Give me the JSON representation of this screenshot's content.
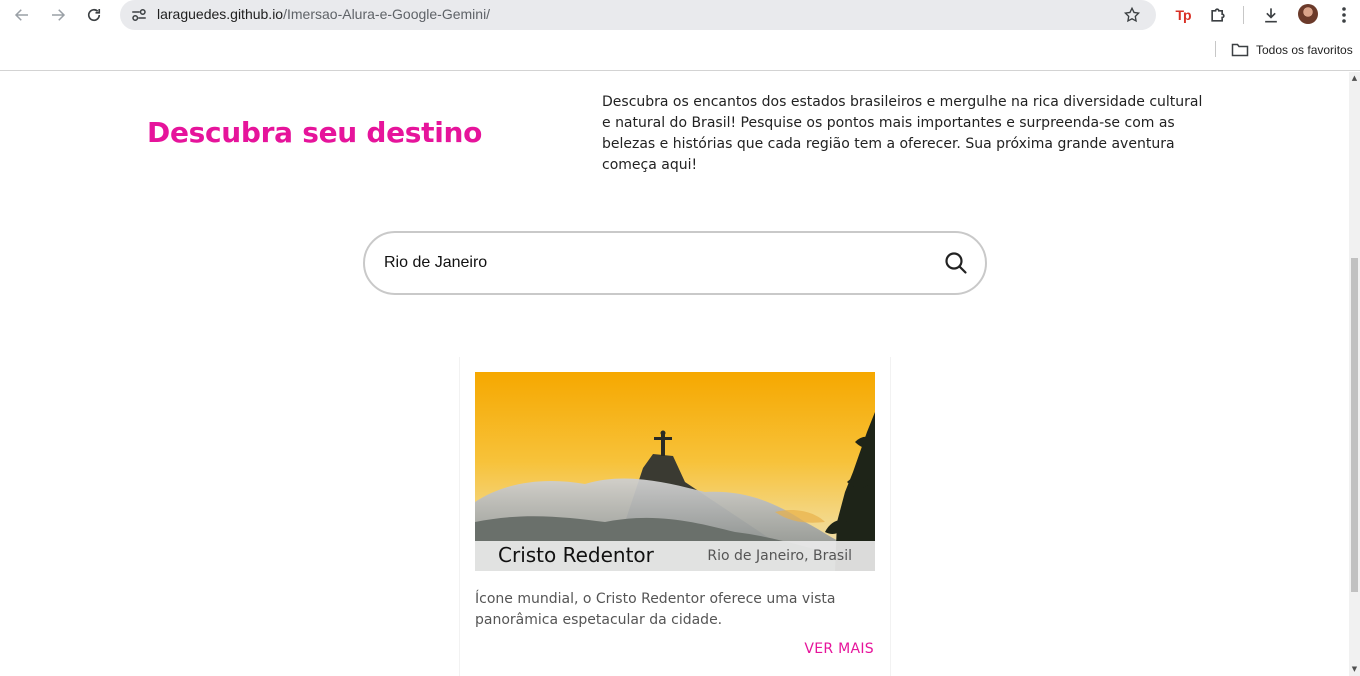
{
  "browser": {
    "url_host": "laraguedes.github.io",
    "url_path": "/Imersao-Alura-e-Google-Gemini/",
    "extension_badge": "Tp",
    "bookmarks_folder_label": "Todos os favoritos",
    "icons": [
      "back-icon",
      "forward-icon",
      "reload-icon",
      "site-info-icon",
      "star-icon",
      "extensions-icon",
      "download-icon",
      "menu-icon",
      "folder-icon"
    ]
  },
  "header": {
    "title": "Descubra seu destino",
    "intro": "Descubra os encantos dos estados brasileiros e mergulhe na rica diversidade cultural e natural do Brasil! Pesquise os pontos mais importantes e surpreenda-se com as belezas e histórias que cada região tem a oferecer. Sua próxima grande aventura começa aqui!"
  },
  "search": {
    "value": "Rio de Janeiro",
    "placeholder": ""
  },
  "results": [
    {
      "title": "Cristo Redentor",
      "location": "Rio de Janeiro, Brasil",
      "description": "Ícone mundial, o Cristo Redentor oferece uma vista panorâmica espetacular da cidade.",
      "link_label": "VER MAIS"
    }
  ],
  "colors": {
    "accent": "#e6149b",
    "text": "#222222",
    "muted": "#555555"
  }
}
